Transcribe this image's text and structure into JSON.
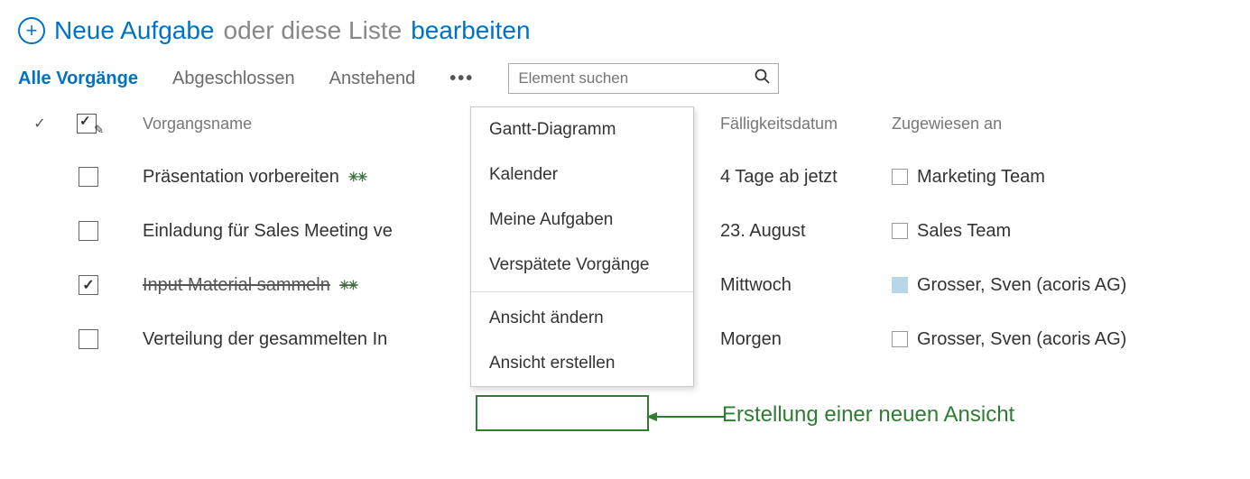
{
  "header": {
    "new_task": "Neue Aufgabe",
    "middle_text": "oder diese Liste",
    "edit_link": "bearbeiten"
  },
  "views": {
    "active": "Alle Vorgänge",
    "completed": "Abgeschlossen",
    "pending": "Anstehend",
    "more": "•••"
  },
  "search": {
    "placeholder": "Element suchen"
  },
  "columns": {
    "name": "Vorgangsname",
    "due": "Fälligkeitsdatum",
    "assigned": "Zugewiesen an"
  },
  "rows": [
    {
      "checked": false,
      "name": "Präsentation vorbereiten",
      "is_new": true,
      "done": false,
      "due": "4 Tage ab jetzt",
      "assigned": "Marketing Team",
      "assigned_filled": false
    },
    {
      "checked": false,
      "name": "Einladung für Sales Meeting ve",
      "is_new": false,
      "done": false,
      "due": "23. August",
      "assigned": "Sales Team",
      "assigned_filled": false
    },
    {
      "checked": true,
      "name": "Input Material sammeln",
      "is_new": true,
      "done": true,
      "due": "Mittwoch",
      "assigned": "Grosser, Sven (acoris AG)",
      "assigned_filled": true
    },
    {
      "checked": false,
      "name": "Verteilung der gesammelten In",
      "is_new": false,
      "done": false,
      "due": "Morgen",
      "assigned": "Grosser, Sven (acoris AG)",
      "assigned_filled": false
    }
  ],
  "dropdown": {
    "items_top": [
      "Gantt-Diagramm",
      "Kalender",
      "Meine Aufgaben",
      "Verspätete Vorgänge"
    ],
    "items_bottom": [
      "Ansicht ändern",
      "Ansicht erstellen"
    ]
  },
  "annotation": {
    "text": "Erstellung einer neuen Ansicht"
  },
  "new_badge_glyph": "✳✳"
}
